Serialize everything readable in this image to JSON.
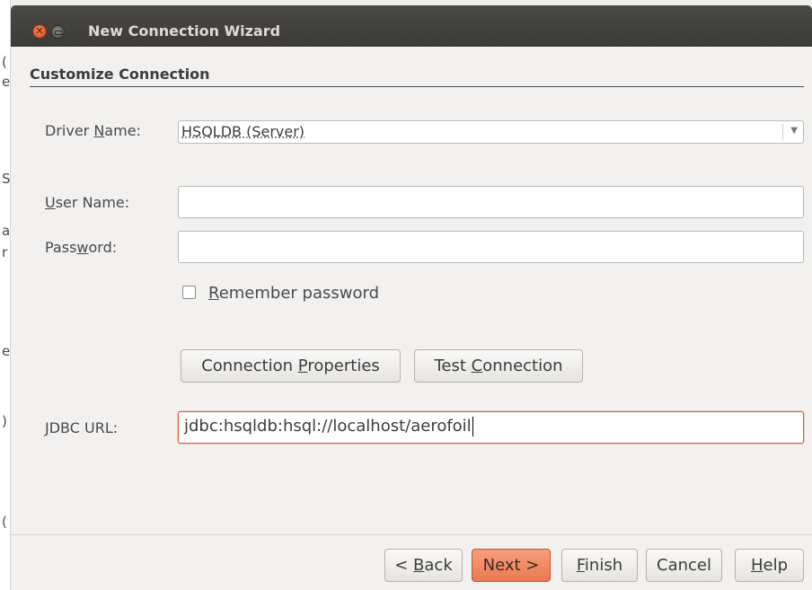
{
  "window": {
    "title": "New Connection Wizard"
  },
  "section": {
    "title": "Customize Connection"
  },
  "driver": {
    "label_pre": "Driver ",
    "label_key": "N",
    "label_post": "ame:",
    "value": "HSQLDB (Server)"
  },
  "username": {
    "label_key": "U",
    "label_post": "ser Name:",
    "value": ""
  },
  "password": {
    "label_pre": "Pass",
    "label_key": "w",
    "label_post": "ord:",
    "value": ""
  },
  "remember": {
    "label_key": "R",
    "label_post": "emember password",
    "checked": false
  },
  "buttons": {
    "conn_props_pre": "Connection ",
    "conn_props_key": "P",
    "conn_props_post": "roperties",
    "test_pre": "Test ",
    "test_key": "C",
    "test_post": "onnection"
  },
  "jdbc": {
    "label_key": "J",
    "label_post": "DBC URL:",
    "value": "jdbc:hsqldb:hsql://localhost/aerofoil"
  },
  "nav": {
    "back_pre": "< ",
    "back_key": "B",
    "back_post": "ack",
    "next": "Next >",
    "finish_key": "F",
    "finish_post": "inish",
    "cancel": "Cancel",
    "help_key": "H",
    "help_post": "elp"
  },
  "background_window": {
    "fragments": [
      "(",
      "e",
      "S",
      "a",
      "r",
      "e",
      ")",
      "("
    ]
  },
  "colors": {
    "titlebar": "#3c3b37",
    "accent": "#e05a2a",
    "window_bg": "#f2f1f0"
  }
}
